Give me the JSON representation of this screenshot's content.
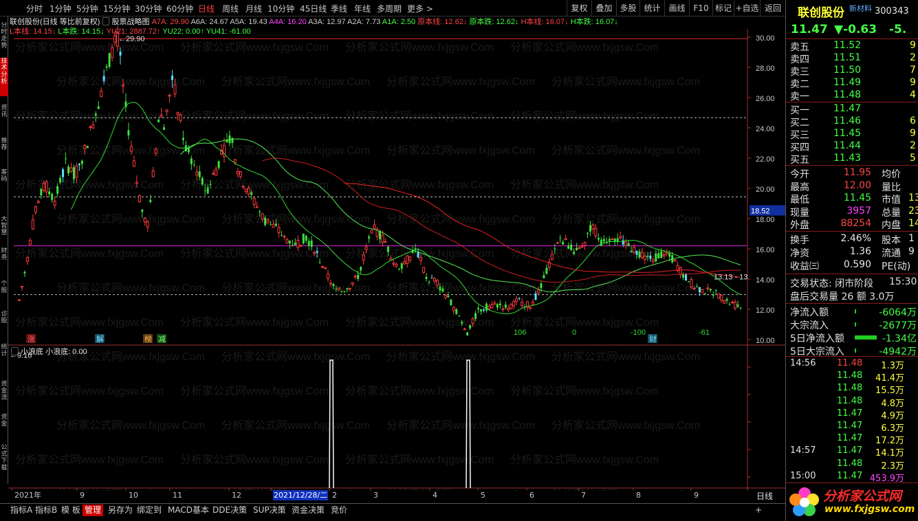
{
  "toolbar": {
    "periods": [
      "分时",
      "1分钟",
      "5分钟",
      "15分钟",
      "30分钟",
      "60分钟",
      "日线",
      "周线",
      "月线",
      "10分钟",
      "45日线",
      "季线",
      "年线",
      "多周期",
      "更多 >"
    ],
    "active_period": "日线",
    "right_buttons": [
      "复权",
      "叠加",
      "多股",
      "统计",
      "画线",
      "F10",
      "标记",
      "+自选",
      "返回"
    ]
  },
  "side_tabs": [
    "分时走势",
    "技术分析",
    "资讯",
    "推荐",
    "筹码",
    "大智慧",
    "财务",
    "个股",
    "诊股",
    "统计",
    "资金流",
    "资金",
    "公式下载"
  ],
  "chart": {
    "title_line": "联创股份(日线 等比前复权)",
    "indicator_name": "股票战略图",
    "legend1": [
      {
        "t": "A7A: 29.90",
        "c": "#ff4444"
      },
      {
        "t": "A6A: 24.67",
        "c": "#cccccc"
      },
      {
        "t": "A5A: 19.43",
        "c": "#cccccc"
      },
      {
        "t": "A4A: 16.20",
        "c": "#ff44ff"
      },
      {
        "t": "A3A: 12.97",
        "c": "#cccccc"
      },
      {
        "t": "A2A: 7.73",
        "c": "#cccccc"
      },
      {
        "t": "A1A: 2.50",
        "c": "#44ff44"
      },
      {
        "t": "原本线: 12.62↓",
        "c": "#ff4444"
      },
      {
        "t": "原本跌: 12.62↓",
        "c": "#44ff44"
      },
      {
        "t": "H本线: 16.07↓",
        "c": "#ff4444"
      },
      {
        "t": "H本跌: 16.07↓",
        "c": "#44ff44"
      }
    ],
    "legend2": [
      {
        "t": "L本线: 14.15↓",
        "c": "#ff4444"
      },
      {
        "t": "L本跌: 14.15↓",
        "c": "#44ff44"
      },
      {
        "t": "YU21: 2887.72↑",
        "c": "#ff4444"
      },
      {
        "t": "YU22: 0.00↑",
        "c": "#44ff44"
      },
      {
        "t": "YU41: -61.00",
        "c": "#44ff44"
      }
    ],
    "high_marker": "29.90",
    "low_marker": "9.16",
    "right_marker": "13.13 - 13",
    "current_price_tag": "18.52",
    "y_ticks": [
      "30.00",
      "28.00",
      "26.00",
      "24.00",
      "22.00",
      "20.00",
      "18.00",
      "16.00",
      "14.00",
      "12.00",
      "10.00"
    ],
    "bottom_signals": [
      {
        "t": "涨",
        "kind": "red"
      },
      {
        "t": "解",
        "kind": "cyan"
      },
      {
        "t": "榜",
        "kind": "orange"
      },
      {
        "t": "减",
        "kind": "green"
      },
      {
        "t": "106",
        "kind": "num"
      },
      {
        "t": "0",
        "kind": "num"
      },
      {
        "t": "-100",
        "kind": "num"
      },
      {
        "t": "财",
        "kind": "cyan"
      },
      {
        "t": "-61",
        "kind": "num"
      }
    ],
    "sub_title": "小浪底",
    "sub_value": "小浪底: 0.00",
    "x_labels": [
      "2021年",
      "9",
      "10",
      "11",
      "12",
      "2021/12/28/二",
      "2",
      "3",
      "4",
      "5",
      "6",
      "7",
      "8",
      "9"
    ],
    "period_label": "日线",
    "watermark": "分析家公式网www.fxjgsw.Com"
  },
  "bottom_tabs": [
    "指标A",
    "指标B",
    "模 板",
    "管理",
    "另存为",
    "绑定到",
    "MACD基本",
    "DDE决策",
    "SUP决策",
    "资金决策",
    "竞价"
  ],
  "active_bottom_tab": "管理",
  "quote": {
    "name": "联创股份",
    "tag": "新材料",
    "code": "300343",
    "price": "11.47",
    "change": "▼-0.63",
    "pct": "-5.",
    "asks": [
      {
        "label": "卖五",
        "price": "11.52",
        "vol": "9"
      },
      {
        "label": "卖四",
        "price": "11.51",
        "vol": "2"
      },
      {
        "label": "卖三",
        "price": "11.50",
        "vol": "7"
      },
      {
        "label": "卖二",
        "price": "11.49",
        "vol": "9"
      },
      {
        "label": "卖一",
        "price": "11.48",
        "vol": "4"
      }
    ],
    "bids": [
      {
        "label": "买一",
        "price": "11.47",
        "vol": ""
      },
      {
        "label": "买二",
        "price": "11.46",
        "vol": "6"
      },
      {
        "label": "买三",
        "price": "11.45",
        "vol": "9"
      },
      {
        "label": "买四",
        "price": "11.44",
        "vol": "2"
      },
      {
        "label": "买五",
        "price": "11.43",
        "vol": "5"
      }
    ],
    "stats": [
      {
        "l1": "今开",
        "v1": "11.95",
        "c1": "#ff4444",
        "l2": "均价",
        "v2": ""
      },
      {
        "l1": "最高",
        "v1": "12.00",
        "c1": "#ff4444",
        "l2": "量比",
        "v2": ""
      },
      {
        "l1": "最低",
        "v1": "11.45",
        "c1": "#44ff44",
        "l2": "市值",
        "v2": "13"
      },
      {
        "l1": "现量",
        "v1": "3957",
        "c1": "#ff44ff",
        "l2": "总量",
        "v2": "23"
      },
      {
        "l1": "外盘",
        "v1": "88254",
        "c1": "#ff4444",
        "l2": "内盘",
        "v2": "14"
      }
    ],
    "stats2": [
      {
        "l1": "换手",
        "v1": "2.46%",
        "l2": "股本",
        "v2": "1"
      },
      {
        "l1": "净资",
        "v1": "1.36",
        "l2": "流通",
        "v2": "9"
      },
      {
        "l1": "收益㈢",
        "v1": "0.590",
        "l2": "PE(动)",
        "v2": ""
      }
    ],
    "trade_status": "交易状态: 闭市阶段",
    "trade_time": "15:30",
    "after_hours": "盘后交易量 26 额 3.0万",
    "flows": [
      {
        "label": "净流入额",
        "value": "-6064万"
      },
      {
        "label": "大宗流入",
        "value": "-2677万"
      },
      {
        "label": "5日净流入额",
        "value": "-1.34亿"
      },
      {
        "label": "5日大宗流入",
        "value": "-4942万"
      }
    ],
    "ticks": [
      {
        "time": "14:56",
        "price": "11.48",
        "vol": "1.3万",
        "pc": "#ff4444",
        "vc": "#ffff44"
      },
      {
        "time": "",
        "price": "11.48",
        "vol": "41.4万",
        "pc": "#44ff44",
        "vc": "#ffff44"
      },
      {
        "time": "",
        "price": "11.48",
        "vol": "15.5万",
        "pc": "#44ff44",
        "vc": "#ffff44"
      },
      {
        "time": "",
        "price": "11.48",
        "vol": "4.8万",
        "pc": "#44ff44",
        "vc": "#ffff44"
      },
      {
        "time": "",
        "price": "11.47",
        "vol": "4.9万",
        "pc": "#44ff44",
        "vc": "#ffff44"
      },
      {
        "time": "",
        "price": "11.47",
        "vol": "6.3万",
        "pc": "#44ff44",
        "vc": "#ffff44"
      },
      {
        "time": "",
        "price": "11.47",
        "vol": "17.2万",
        "pc": "#44ff44",
        "vc": "#ffff44"
      },
      {
        "time": "14:57",
        "price": "11.47",
        "vol": "14.1万",
        "pc": "#44ff44",
        "vc": "#ffff44"
      },
      {
        "time": "",
        "price": "11.48",
        "vol": "2.3万",
        "pc": "#44ff44",
        "vc": "#ffff44"
      },
      {
        "time": "15:00",
        "price": "11.47",
        "vol": "453.9万",
        "pc": "#44ff44",
        "vc": "#ff44ff"
      }
    ],
    "logo_text": "分析家公式网",
    "logo_url": "www.fxjgsw.com"
  },
  "chart_data": {
    "type": "candlestick",
    "ylim": [
      9.16,
      29.9
    ],
    "reference_levels": [
      29.9,
      24.67,
      19.43,
      16.2,
      12.97
    ],
    "indicator_series": [
      {
        "name": "小浪底",
        "values": [
          0.0
        ]
      }
    ]
  }
}
